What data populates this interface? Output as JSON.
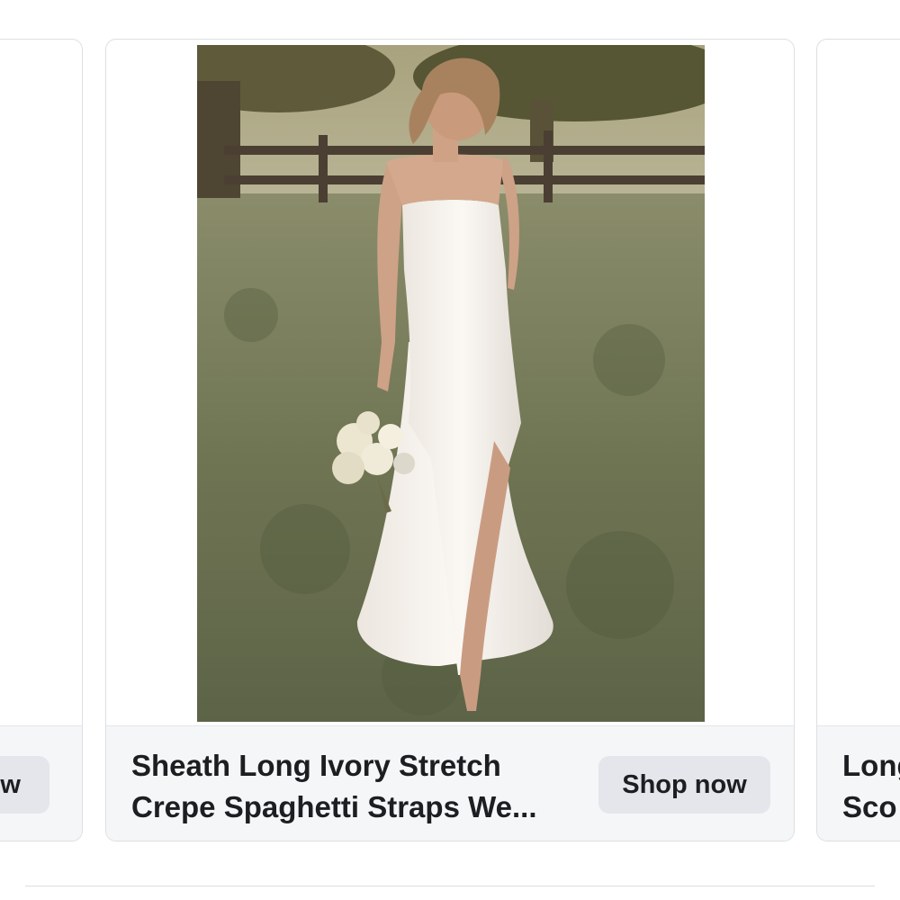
{
  "carousel": {
    "cards": [
      {
        "position": "left",
        "title": "",
        "button_label": "ow"
      },
      {
        "position": "center",
        "title_lines": [
          "Sheath Long Ivory Stretch",
          "Crepe Spaghetti Straps We..."
        ],
        "button_label": "Shop now",
        "image_icon": "bride-photo"
      },
      {
        "position": "right",
        "title_lines": [
          "Long",
          "Sco"
        ],
        "button_label": ""
      }
    ]
  },
  "colors": {
    "card_border": "#dddfe2",
    "footer_bg": "#f5f6f7",
    "button_bg": "#e4e6eb",
    "text": "#1c1e21"
  }
}
